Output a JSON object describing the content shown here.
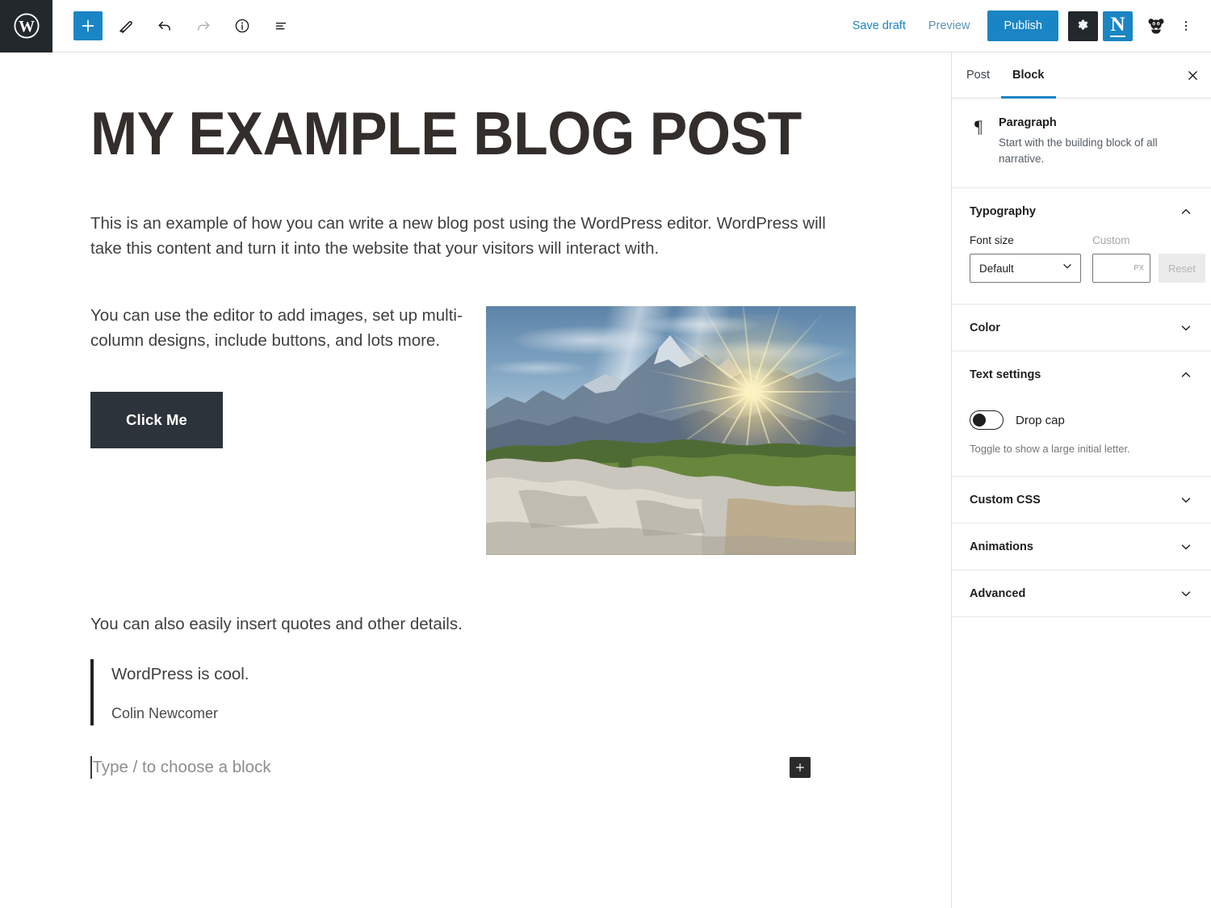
{
  "topbar": {
    "logo_icon": "wordpress-logo-icon",
    "add_block_icon": "plus-icon",
    "edit_icon": "pencil-icon",
    "undo_icon": "undo-arrow-icon",
    "redo_icon": "redo-arrow-icon",
    "info_icon": "info-circle-icon",
    "list_view_icon": "list-view-icon",
    "save_draft_label": "Save draft",
    "preview_label": "Preview",
    "publish_label": "Publish",
    "settings_icon": "gear-icon",
    "nelio_icon": "N",
    "avatar_icon": "panda-avatar-icon",
    "more_icon": "kebab-menu-icon",
    "accent_color": "#1a85c4",
    "dark_color": "#23282d"
  },
  "editor": {
    "title": "MY EXAMPLE BLOG POST",
    "paragraph_1": "This is an example of how you can write a new blog post using the WordPress editor. WordPress will take this content and turn it into the website that your visitors will interact with.",
    "paragraph_2": "You can use the editor to add images, set up multi-column designs, include buttons, and lots more.",
    "button_label": "Click Me",
    "image_alt": "mountain-sunset-photo",
    "paragraph_3": "You can also easily insert quotes and other details.",
    "quote_text": "WordPress is cool.",
    "quote_citation": "Colin Newcomer",
    "empty_placeholder": "Type / to choose a block",
    "inserter_icon": "plus-icon",
    "button_bg": "#2d333a",
    "title_color": "#332e2b"
  },
  "sidebar": {
    "tabs": [
      {
        "label": "Post",
        "active": false
      },
      {
        "label": "Block",
        "active": true
      }
    ],
    "close_icon": "close-icon",
    "block_card": {
      "icon": "paragraph-pilcrow-icon",
      "glyph": "¶",
      "title": "Paragraph",
      "description": "Start with the building block of all narrative."
    },
    "typography": {
      "title": "Typography",
      "expanded": true,
      "chevron_icon": "chevron-up-icon",
      "font_size_label": "Font size",
      "font_size_value": "Default",
      "custom_label": "Custom",
      "custom_value": "",
      "custom_unit": "PX",
      "reset_label": "Reset"
    },
    "color": {
      "title": "Color",
      "expanded": false,
      "chevron_icon": "chevron-down-icon"
    },
    "text_settings": {
      "title": "Text settings",
      "expanded": true,
      "chevron_icon": "chevron-up-icon",
      "drop_cap_label": "Drop cap",
      "drop_cap_on": false,
      "help_text": "Toggle to show a large initial letter."
    },
    "custom_css": {
      "title": "Custom CSS",
      "expanded": false,
      "chevron_icon": "chevron-down-icon"
    },
    "animations": {
      "title": "Animations",
      "expanded": false,
      "chevron_icon": "chevron-down-icon"
    },
    "advanced": {
      "title": "Advanced",
      "expanded": false,
      "chevron_icon": "chevron-down-icon"
    }
  }
}
